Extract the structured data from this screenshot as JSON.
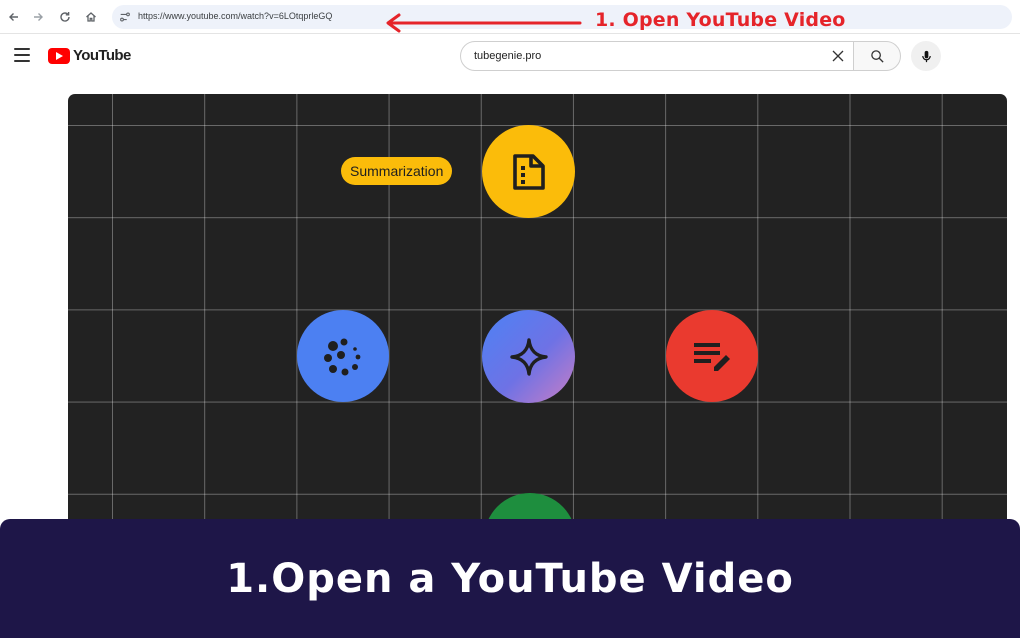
{
  "browser": {
    "url": "https://www.youtube.com/watch?v=6LOtqprleGQ",
    "icons": [
      "back-icon",
      "forward-icon",
      "reload-icon",
      "home-icon",
      "site-info-icon"
    ]
  },
  "annotation": {
    "label": "1. Open YouTube Video",
    "color": "#e5242a"
  },
  "youtube": {
    "logo_text": "YouTube",
    "search_value": "tubegenie.pro",
    "brand_color": "#ff0000"
  },
  "video": {
    "pill_label": "Summarization",
    "circles": [
      {
        "icon": "document-icon",
        "color": "#fbbc0a"
      },
      {
        "icon": "loading-dots-icon",
        "color": "#4c80f2"
      },
      {
        "icon": "gemini-sparkle-icon",
        "color": "#4d82f5"
      },
      {
        "icon": "edit-notes-icon",
        "color": "#ea3a2f"
      },
      {
        "icon": "circle-icon",
        "color": "#1e8e3e"
      }
    ]
  },
  "banner": {
    "text": "1.Open a YouTube Video",
    "background": "#1e1648"
  }
}
